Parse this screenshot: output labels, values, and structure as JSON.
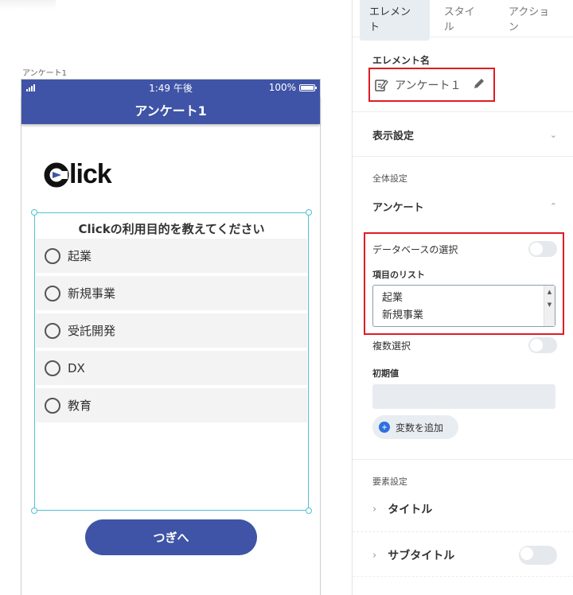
{
  "canvas": {
    "frame_label": "アンケート1",
    "status_bar": {
      "time": "1:49 午後",
      "battery": "100%"
    },
    "nav_title": "アンケート1",
    "logo_text": "Click",
    "survey": {
      "title": "Clickの利用目的を教えてください",
      "options": [
        "起業",
        "新規事業",
        "受託開発",
        "DX",
        "教育"
      ]
    },
    "next_button": "つぎへ"
  },
  "panel": {
    "tabs": [
      "エレメント",
      "スタイル",
      "アクション"
    ],
    "element_name_label": "エレメント名",
    "element_name_value": "アンケート１",
    "display_settings": "表示設定",
    "global_settings": "全体設定",
    "survey_section": "アンケート",
    "db_select_label": "データベースの選択",
    "item_list_label": "項目のリスト",
    "item_list_lines": [
      "起業",
      "新規事業"
    ],
    "multi_select_label": "複数選択",
    "initial_value_label": "初期値",
    "add_variable": "変数を追加",
    "element_settings": "要素設定",
    "title_item": "タイトル",
    "subtitle_item": "サブタイトル"
  },
  "colors": {
    "brand": "#3f54a6",
    "selection": "#4fc3d0",
    "highlight": "#e01b24",
    "accent": "#2f6fe0"
  },
  "icons": [
    "signal-icon",
    "battery-icon",
    "click-logo-icon",
    "edit-document-icon",
    "pencil-icon",
    "chevron-down-icon",
    "chevron-up-icon",
    "chevron-right-icon",
    "plus-icon"
  ]
}
